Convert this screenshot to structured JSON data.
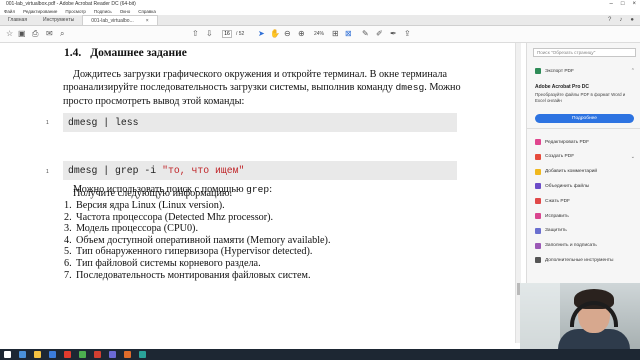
{
  "window": {
    "title": "001-lab_virtualbox.pdf - Adobe Acrobat Reader DC (64-bit)"
  },
  "menu": [
    "Файл",
    "Редактирование",
    "Просмотр",
    "Подпись",
    "Окно",
    "Справка"
  ],
  "tabs": {
    "home": "Главная",
    "tools": "Инструменты",
    "doc": "001-lab_virtualbo..."
  },
  "toolbar": {
    "page_current": "16",
    "page_total": "/ 52",
    "zoom": "24%"
  },
  "document": {
    "heading_number": "1.4.",
    "heading_title": "Домашнее задание",
    "para1_text": "Дождитесь загрузки графического окружения и откройте терминал. В окне терминала проанализируйте последовательность загрузки системы, выполнив команду ",
    "para1_cmd": "dmesg",
    "para1_end": ". Можно просто просмотреть вывод этой команды:",
    "code1_lineno": "1",
    "code1": "dmesg | less",
    "para2_text": "Можно использовать поиск с помощью ",
    "para2_cmd": "grep",
    "para2_end": ":",
    "code2_lineno": "1",
    "code2_cmd": "dmesg | grep -i ",
    "code2_str": "\"то, что ищем\"",
    "para3": "Получите следующую информацию.",
    "list": [
      {
        "n": "1.",
        "text": "Версия ядра Linux (Linux version)."
      },
      {
        "n": "2.",
        "text": "Частота процессора (Detected Mhz processor)."
      },
      {
        "n": "3.",
        "text": "Модель процессора (CPU0)."
      },
      {
        "n": "4.",
        "text": "Объем доступной оперативной памяти (Memory available)."
      },
      {
        "n": "5.",
        "text": "Тип обнаруженного гипервизора (Hypervisor detected)."
      },
      {
        "n": "6.",
        "text": "Тип файловой системы корневого раздела."
      },
      {
        "n": "7.",
        "text": "Последовательность монтирования файловых систем."
      }
    ]
  },
  "right_panel": {
    "search_placeholder": "Поиск \"Обрезать страницу\"",
    "export_pdf": "Экспорт PDF",
    "promo_title": "Adobe Acrobat Pro DC",
    "promo_text": "Преобразуйте файлы PDF в формат Word и Excel онлайн",
    "promo_button": "Подробнее",
    "tools": [
      {
        "label": "Редактировать PDF",
        "color": "#e0458e"
      },
      {
        "label": "Создать PDF",
        "color": "#e64b3c"
      },
      {
        "label": "Добавить комментарий",
        "color": "#f0b81d"
      },
      {
        "label": "Объединить файлы",
        "color": "#6c4cc8"
      },
      {
        "label": "Сжать PDF",
        "color": "#e04848"
      },
      {
        "label": "Исправить",
        "color": "#d9468f"
      },
      {
        "label": "Защитить",
        "color": "#6a6fcf"
      },
      {
        "label": "Заполнить и подписать",
        "color": "#9b59b6"
      },
      {
        "label": "Дополнительные инструменты",
        "color": "#555555"
      }
    ]
  }
}
